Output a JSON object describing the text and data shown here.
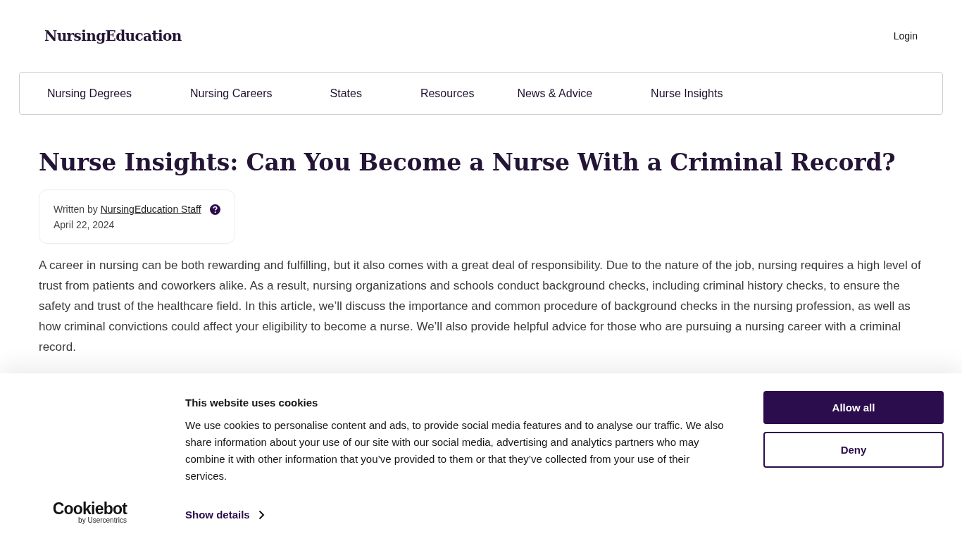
{
  "header": {
    "logo": "NursingEducation",
    "login": "Login"
  },
  "nav": [
    {
      "label": "Nursing Degrees"
    },
    {
      "label": "Nursing Careers"
    },
    {
      "label": "States"
    },
    {
      "label": "Resources"
    },
    {
      "label": "News & Advice"
    },
    {
      "label": "Nurse Insights"
    }
  ],
  "article": {
    "title": "Nurse Insights: Can You Become a Nurse With a Criminal Record?",
    "byline_prefix": "Written by",
    "author": "NursingEducation Staff",
    "date": "April 22, 2024",
    "intro": "A career in nursing can be both rewarding and fulfilling, but it also comes with a great deal of responsibility. Due to the nature of the job, nursing requires a high level of trust from patients and coworkers alike. As a result, nursing organizations and schools conduct background checks, including criminal history checks, to ensure the safety and trust of the healthcare field. In this article, we’ll discuss the importance and common procedure of background checks in the nursing profession, as well as how criminal convictions could affect your eligibility to become a nurse. We’ll also provide helpful advice for those who are pursuing a nursing career with a criminal record."
  },
  "cookie_banner": {
    "logo": "Cookiebot",
    "logo_sub": "by Usercentrics",
    "title": "This website uses cookies",
    "text": "We use cookies to personalise content and ads, to provide social media features and to analyse our traffic. We also share information about your use of our site with our social media, advertising and analytics partners who may combine it with other information that you’ve provided to them or that they’ve collected from your use of their services.",
    "details_link": "Show details",
    "buttons": [
      {
        "label": "Allow all",
        "kind": "primary"
      },
      {
        "label": "Deny",
        "kind": "outline"
      }
    ]
  }
}
